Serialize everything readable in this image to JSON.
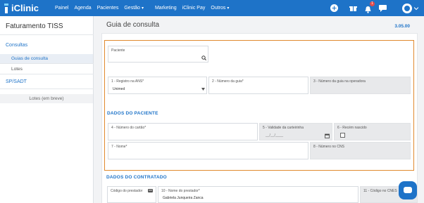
{
  "brand": {
    "name": "iClinic"
  },
  "nav": {
    "items": [
      "Painel",
      "Agenda",
      "Pacientes",
      "Gestão",
      "Marketing",
      "iClinic Pay",
      "Outros"
    ],
    "dropdown_caret": "▾",
    "notification_count": "1"
  },
  "sidebar": {
    "title": "Faturamento TISS",
    "section_consultas": "Consultas",
    "item_guias": "Guias de consulta",
    "item_lotes": "Lotes",
    "section_sadt": "SP/SADT",
    "item_lotes_breve": "Lotes (em breve)"
  },
  "main": {
    "title": "Guia de consulta",
    "version": "3.05.00"
  },
  "form": {
    "paciente_label": "Paciente",
    "registro_ans_label": "1 - Registro na ANS*",
    "registro_ans_value": "Unimed",
    "numero_guia_label": "2 - Número da guia*",
    "numero_guia_operadora_label": "3 - Número da guia na operadora",
    "dados_paciente_title": "DADOS DO PACIENTE",
    "numero_cartao_label": "4 - Número do cartão*",
    "validade_carteirinha_label": "5 - Validade da carteirinha",
    "validade_placeholder": "__/__/____",
    "recem_nascido_label": "6 - Recém nascido",
    "nome_label": "7 - Nome*",
    "numero_cns_label": "8 - Número no CNS",
    "dados_contratado_title": "DADOS DO CONTRATADO",
    "codigo_prestador_label": "Código do prestador",
    "nome_prestador_label": "10 - Nome do prestador*",
    "nome_prestador_value": "Gabriela Junqueira Zanca",
    "codigo_cnes_label": "11 - Código no CNES"
  },
  "colors": {
    "accent": "#1e73c8",
    "highlight_frame": "#e08a2e"
  },
  "icons": [
    "search-icon",
    "calendar-icon",
    "chevron-down-icon",
    "card-icon",
    "plus-circle-icon",
    "gift-icon",
    "bell-icon",
    "chat-icon",
    "avatar-icon",
    "chat-widget-icon"
  ]
}
